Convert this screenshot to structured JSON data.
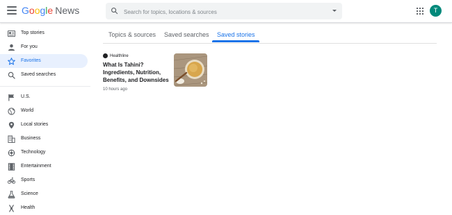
{
  "header": {
    "logo": {
      "letters": [
        "G",
        "o",
        "o",
        "g",
        "l",
        "e"
      ],
      "letter_colors": [
        "#4285f4",
        "#ea4335",
        "#fbbc05",
        "#4285f4",
        "#34a853",
        "#ea4335"
      ],
      "product": "News"
    },
    "menu_icon": "hamburger-menu-icon",
    "search": {
      "placeholder": "Search for topics, locations & sources",
      "value": ""
    },
    "apps_icon": "apps-grid-icon",
    "avatar_initial": "T",
    "avatar_color": "#00897b"
  },
  "sidebar": {
    "items": [
      {
        "label": "Top stories",
        "icon": "newspaper-icon",
        "active": false
      },
      {
        "label": "For you",
        "icon": "person-icon",
        "active": false
      },
      {
        "label": "Favorites",
        "icon": "star-icon",
        "active": true
      },
      {
        "label": "Saved searches",
        "icon": "search-icon",
        "active": false
      },
      {
        "label": "U.S.",
        "icon": "flag-icon",
        "active": false
      },
      {
        "label": "World",
        "icon": "globe-icon",
        "active": false
      },
      {
        "label": "Local stories",
        "icon": "location-pin-icon",
        "active": false
      },
      {
        "label": "Business",
        "icon": "business-building-icon",
        "active": false
      },
      {
        "label": "Technology",
        "icon": "technology-chip-icon",
        "active": false
      },
      {
        "label": "Entertainment",
        "icon": "film-icon",
        "active": false
      },
      {
        "label": "Sports",
        "icon": "bicycle-icon",
        "active": false
      },
      {
        "label": "Science",
        "icon": "science-flask-icon",
        "active": false
      },
      {
        "label": "Health",
        "icon": "health-icon",
        "active": false
      }
    ]
  },
  "tabs": [
    {
      "label": "Topics & sources",
      "active": false
    },
    {
      "label": "Saved searches",
      "active": false
    },
    {
      "label": "Saved stories",
      "active": true
    }
  ],
  "stories": [
    {
      "publisher": "Healthline",
      "headline": "What Is Tahini? Ingredients, Nutrition, Benefits, and Downsides",
      "time": "10 hours ago",
      "thumbnail": "tahini-bowl-image"
    }
  ],
  "colors": {
    "accent": "#1a73e8",
    "active_bg": "#e8f0fe"
  }
}
